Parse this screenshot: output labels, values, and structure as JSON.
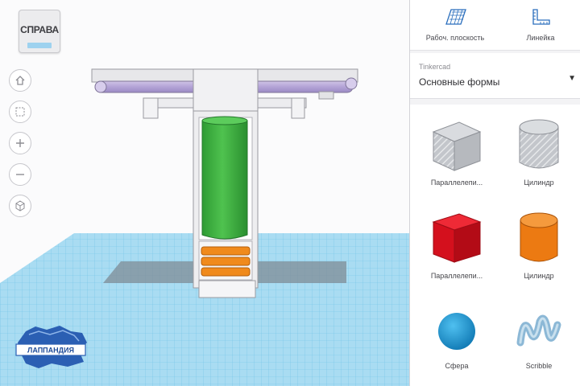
{
  "viewcube": {
    "label": "СПРАВА"
  },
  "nav_tools": [
    "home-icon",
    "fit-view-icon",
    "zoom-in-icon",
    "zoom-out-icon",
    "perspective-icon"
  ],
  "toolbar": {
    "workplane_label": "Рабоч. плоскость",
    "ruler_label": "Линейка"
  },
  "library": {
    "source": "Tinkercad",
    "category": "Основные формы"
  },
  "shapes": [
    {
      "label": "Параллелепи...",
      "icon": "box-hole-icon",
      "color": "#b9bcc2"
    },
    {
      "label": "Цилиндр",
      "icon": "cylinder-hole-icon",
      "color": "#b9bcc2"
    },
    {
      "label": "Параллелепи...",
      "icon": "box-icon",
      "color": "#d9101e"
    },
    {
      "label": "Цилиндр",
      "icon": "cylinder-icon",
      "color": "#ec7a12"
    },
    {
      "label": "Сфера",
      "icon": "sphere-icon",
      "color": "#1a99d3"
    },
    {
      "label": "Scribble",
      "icon": "scribble-icon",
      "color": "#9fc5dc"
    }
  ],
  "watermark": {
    "text": "ЛАППАНДИЯ"
  }
}
